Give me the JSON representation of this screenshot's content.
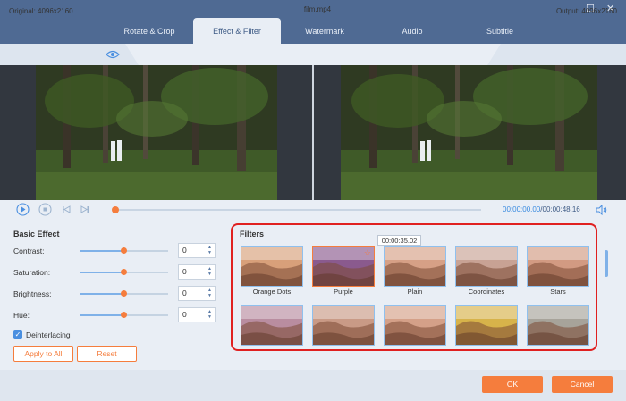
{
  "tabs": [
    "Rotate & Crop",
    "Effect & Filter",
    "Watermark",
    "Audio",
    "Subtitle"
  ],
  "active_tab": "Effect & Filter",
  "window_controls": {
    "maximize": "☐",
    "close": "✕"
  },
  "info": {
    "original": "Original: 4096x2160",
    "filename": "film.mp4",
    "output": "Output: 4096x2160"
  },
  "playback": {
    "current_time": "00:00:00.00",
    "total_time": "/00:00:48.16",
    "progress": 0.0
  },
  "basic_effect": {
    "title": "Basic Effect",
    "controls": [
      {
        "label": "Contrast:",
        "value": "0",
        "level": 0.5
      },
      {
        "label": "Saturation:",
        "value": "0",
        "level": 0.5
      },
      {
        "label": "Brightness:",
        "value": "0",
        "level": 0.5
      },
      {
        "label": "Hue:",
        "value": "0",
        "level": 0.5
      }
    ],
    "deinterlacing_label": "Deinterlacing",
    "deinterlacing_checked": true,
    "apply_to_all": "Apply to All",
    "reset": "Reset"
  },
  "filters": {
    "title": "Filters",
    "tooltip": "00:00:35.02",
    "items": [
      {
        "label": "Orange Dots",
        "tint": "#d8a07a"
      },
      {
        "label": "Purple",
        "tint": "#8a5a8e"
      },
      {
        "label": "Plain",
        "tint": "#d6a086"
      },
      {
        "label": "Coordinates",
        "tint": "#c8a294"
      },
      {
        "label": "Stars",
        "tint": "#d29a82"
      }
    ],
    "row2": [
      {
        "tint": "#b98da0"
      },
      {
        "tint": "#c99a86"
      },
      {
        "tint": "#d4a088"
      },
      {
        "tint": "#d7b34a"
      },
      {
        "tint": "#a7a39a"
      }
    ]
  },
  "footer": {
    "ok": "OK",
    "cancel": "Cancel"
  },
  "colors": {
    "accent": "#f57d3d",
    "header": "#4f6a93",
    "highlight": "#e02020"
  }
}
